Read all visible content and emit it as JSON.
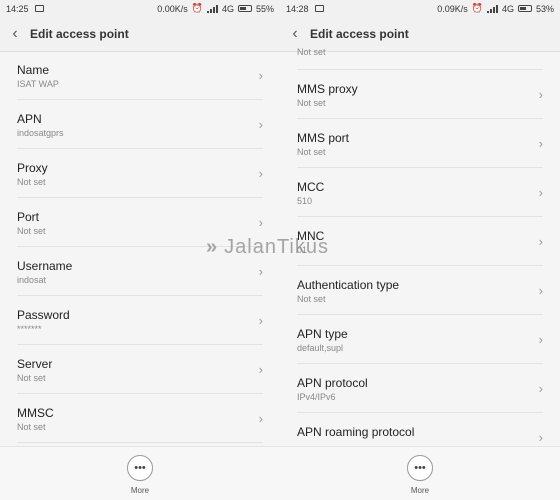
{
  "left": {
    "status": {
      "time": "14:25",
      "speed": "0.00K/s",
      "network": "4G",
      "battery": "55%"
    },
    "title": "Edit access point",
    "items": [
      {
        "label": "Name",
        "value": "ISAT WAP"
      },
      {
        "label": "APN",
        "value": "indosatgprs"
      },
      {
        "label": "Proxy",
        "value": "Not set"
      },
      {
        "label": "Port",
        "value": "Not set"
      },
      {
        "label": "Username",
        "value": "indosat"
      },
      {
        "label": "Password",
        "value": "*******"
      },
      {
        "label": "Server",
        "value": "Not set"
      },
      {
        "label": "MMSC",
        "value": "Not set"
      }
    ],
    "more_label": "More"
  },
  "right": {
    "status": {
      "time": "14:28",
      "speed": "0.09K/s",
      "network": "4G",
      "battery": "53%"
    },
    "title": "Edit access point",
    "partial_value": "Not set",
    "items": [
      {
        "label": "MMS proxy",
        "value": "Not set"
      },
      {
        "label": "MMS port",
        "value": "Not set"
      },
      {
        "label": "MCC",
        "value": "510"
      },
      {
        "label": "MNC",
        "value": "01"
      },
      {
        "label": "Authentication type",
        "value": "Not set"
      },
      {
        "label": "APN type",
        "value": "default,supl"
      },
      {
        "label": "APN protocol",
        "value": "IPv4/IPv6"
      },
      {
        "label": "APN roaming protocol",
        "value": ""
      }
    ],
    "more_label": "More"
  },
  "watermark": "JalanTikus"
}
